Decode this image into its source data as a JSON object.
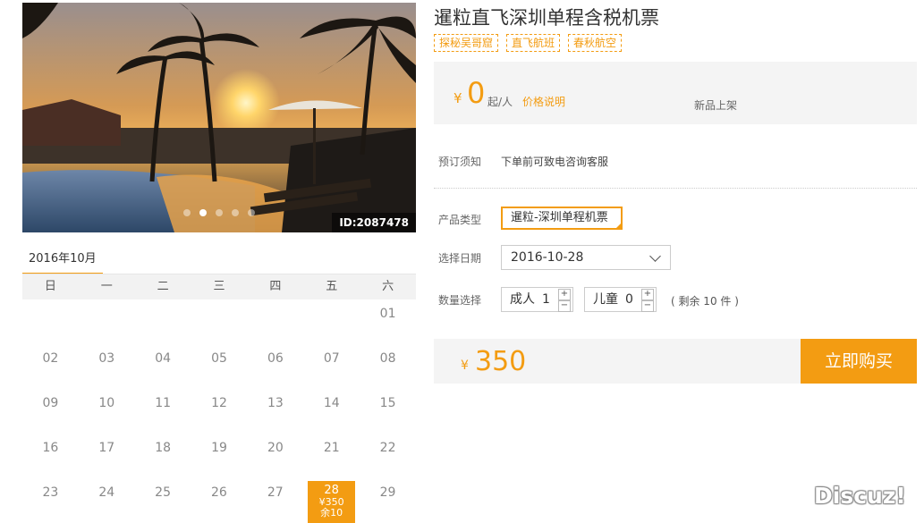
{
  "product": {
    "title": "暹粒直飞深圳单程含税机票",
    "tags": [
      "探秘吴哥窟",
      "直飞航班",
      "春秋航空"
    ],
    "image_id_label": "ID:2087478"
  },
  "price_box": {
    "currency": "¥",
    "value": "0",
    "from_label": "起/人",
    "price_note_link": "价格说明",
    "status": "新品上架"
  },
  "booking": {
    "notice_label": "预订须知",
    "notice_value": "下单前可致电咨询客服",
    "type_label": "产品类型",
    "type_value": "暹粒-深圳单程机票",
    "date_label": "选择日期",
    "date_value": "2016-10-28",
    "qty_label": "数量选择",
    "adult_label": "成人",
    "adult_qty": "1",
    "child_label": "儿童",
    "child_qty": "0",
    "plus": "+",
    "minus": "−",
    "remain_text": "( 剩余 10 件 )"
  },
  "buy": {
    "currency": "¥",
    "total": "350",
    "button_label": "立即购买"
  },
  "calendar": {
    "month_label": "2016年10月",
    "weekdays": [
      "日",
      "一",
      "二",
      "三",
      "四",
      "五",
      "六"
    ],
    "weeks": [
      [
        "",
        "",
        "",
        "",
        "",
        "",
        "01"
      ],
      [
        "02",
        "03",
        "04",
        "05",
        "06",
        "07",
        "08"
      ],
      [
        "09",
        "10",
        "11",
        "12",
        "13",
        "14",
        "15"
      ],
      [
        "16",
        "17",
        "18",
        "19",
        "20",
        "21",
        "22"
      ],
      [
        "23",
        "24",
        "25",
        "26",
        "27",
        "28",
        "29"
      ]
    ],
    "available_day": {
      "day": "28",
      "price": "¥350",
      "remain": "余10"
    }
  },
  "watermark": "Discuz!",
  "colors": {
    "accent": "#f39c12",
    "panel_bg": "#f4f4f4"
  }
}
